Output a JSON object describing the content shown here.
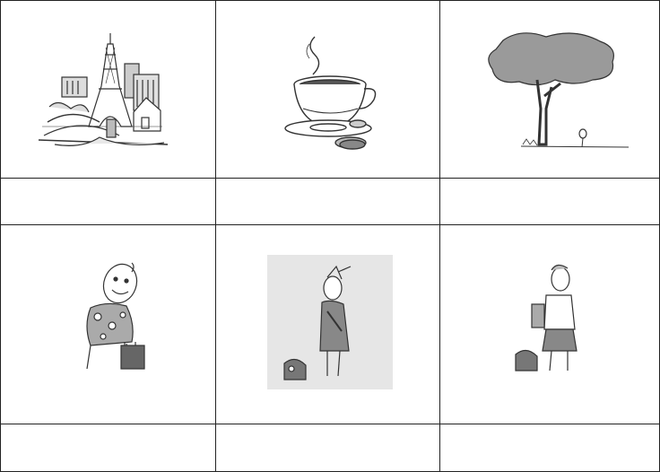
{
  "worksheet": {
    "rows": [
      {
        "pictures": [
          {
            "icon": "paris-eiffel-tower-icon"
          },
          {
            "icon": "coffee-cup-icon"
          },
          {
            "icon": "tree-icon"
          }
        ],
        "answers": [
          "",
          "",
          ""
        ]
      },
      {
        "pictures": [
          {
            "icon": "tourist-with-suitcase-icon"
          },
          {
            "icon": "girl-with-schoolbag-icon"
          },
          {
            "icon": "boy-with-backpack-icon"
          }
        ],
        "answers": [
          "",
          "",
          ""
        ]
      }
    ],
    "colors": {
      "grid": "#222222",
      "ink": "#333333",
      "shade": "#9a9a9a",
      "panel": "#e6e6e6"
    }
  }
}
